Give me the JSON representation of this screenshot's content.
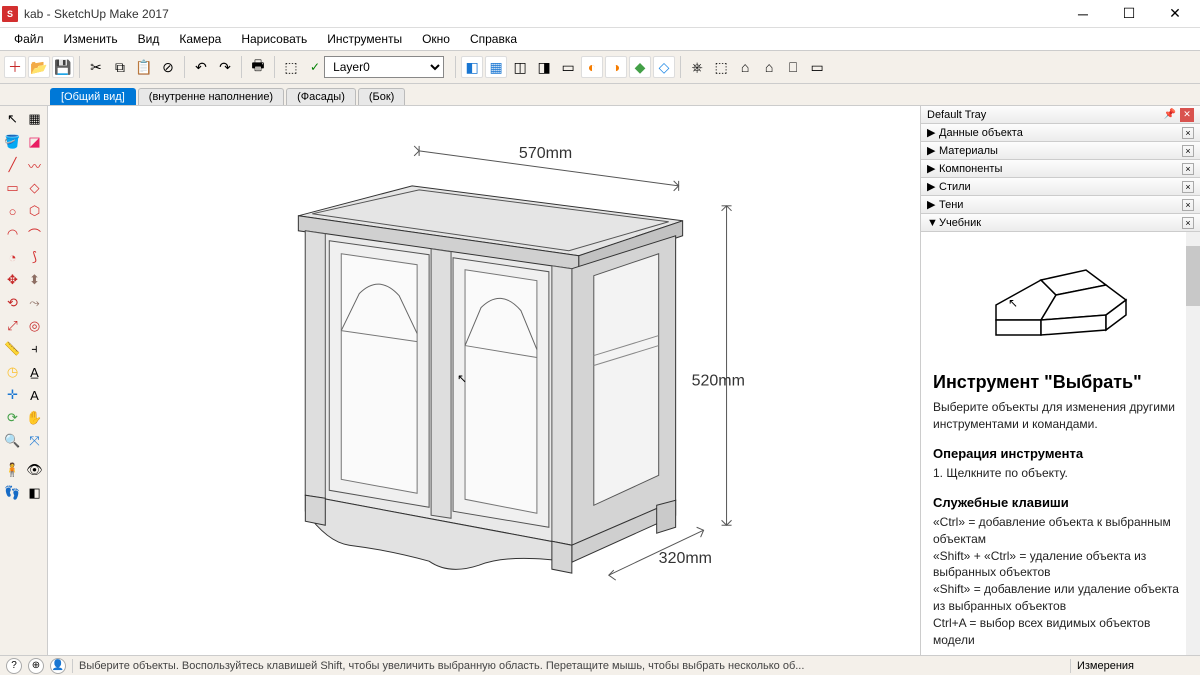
{
  "window": {
    "title": "kab - SketchUp Make 2017"
  },
  "menus": [
    "Файл",
    "Изменить",
    "Вид",
    "Камера",
    "Нарисовать",
    "Инструменты",
    "Окно",
    "Справка"
  ],
  "layer": {
    "selected": "Layer0"
  },
  "scenes": [
    {
      "label": "[Общий вид]",
      "active": true
    },
    {
      "label": "(внутренне наполнение)",
      "active": false
    },
    {
      "label": "(Фасады)",
      "active": false
    },
    {
      "label": "(Бок)",
      "active": false
    }
  ],
  "dimensions": {
    "width": "570mm",
    "height": "520mm",
    "depth": "320mm"
  },
  "tray": {
    "title": "Default Tray",
    "panels": [
      "Данные объекта",
      "Материалы",
      "Компоненты",
      "Стили",
      "Тени",
      "Учебник"
    ],
    "expanded_index": 5,
    "instructor": {
      "title": "Инструмент \"Выбрать\"",
      "desc": "Выберите объекты для изменения другими инструментами и командами.",
      "op_heading": "Операция инструмента",
      "op_text": "1. Щелкните по объекту.",
      "keys_heading": "Служебные клавиши",
      "keys_lines": [
        "«Ctrl» = добавление объекта к выбранным объектам",
        "«Shift» + «Ctrl» = удаление объекта из выбранных объектов",
        "«Shift» = добавление или удаление объекта из выбранных объектов",
        "Ctrl+A = выбор всех видимых объектов модели"
      ]
    }
  },
  "status": {
    "hint": "Выберите объекты. Воспользуйтесь клавишей Shift, чтобы увеличить выбранную область. Перетащите мышь, чтобы выбрать несколько об...",
    "measure_label": "Измерения"
  }
}
